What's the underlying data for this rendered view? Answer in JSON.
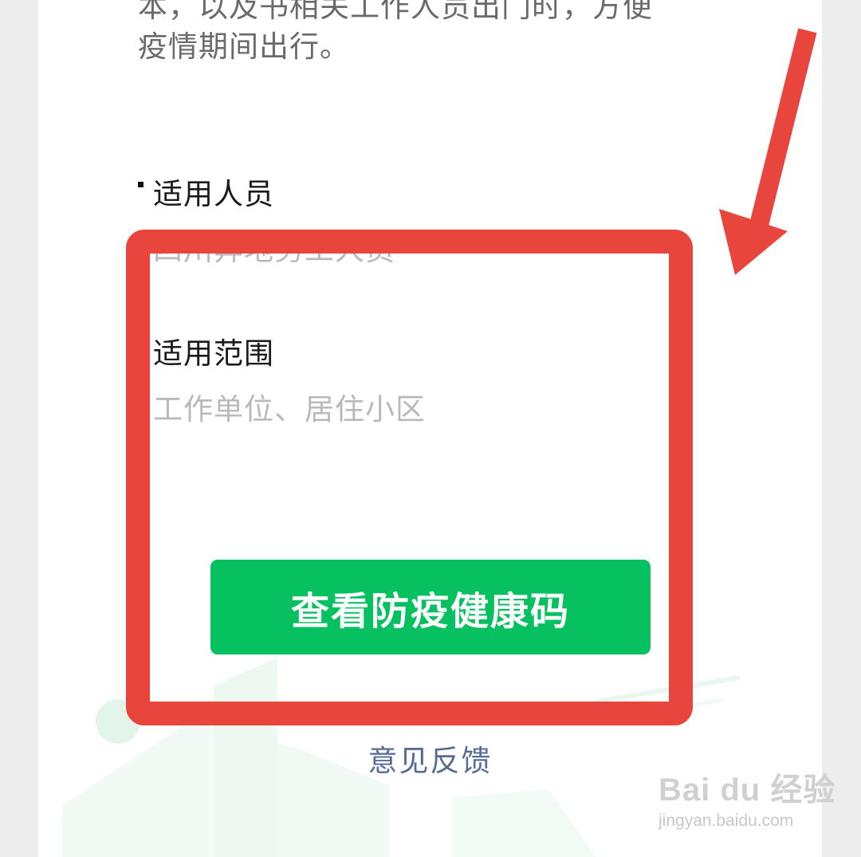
{
  "intro": {
    "partial_top_line": "本，以及书相关工作人员出门时，方便",
    "text": "疫情期间出行。"
  },
  "fields": [
    {
      "label": "适用人员",
      "value": "四川异地务工人员"
    },
    {
      "label": "适用范围",
      "value": "工作单位、居住小区"
    }
  ],
  "actions": {
    "primary_label": "查看防疫健康码",
    "feedback_label": "意见反馈"
  },
  "annotation": {
    "highlight_color": "#e8453c"
  },
  "watermark": {
    "brand": "Bai du 经验",
    "url": "jingyan.baidu.com"
  },
  "theme": {
    "button_color": "#07c160",
    "link_color": "#576b95",
    "page_bg": "#ededed",
    "card_bg": "#ffffff"
  }
}
